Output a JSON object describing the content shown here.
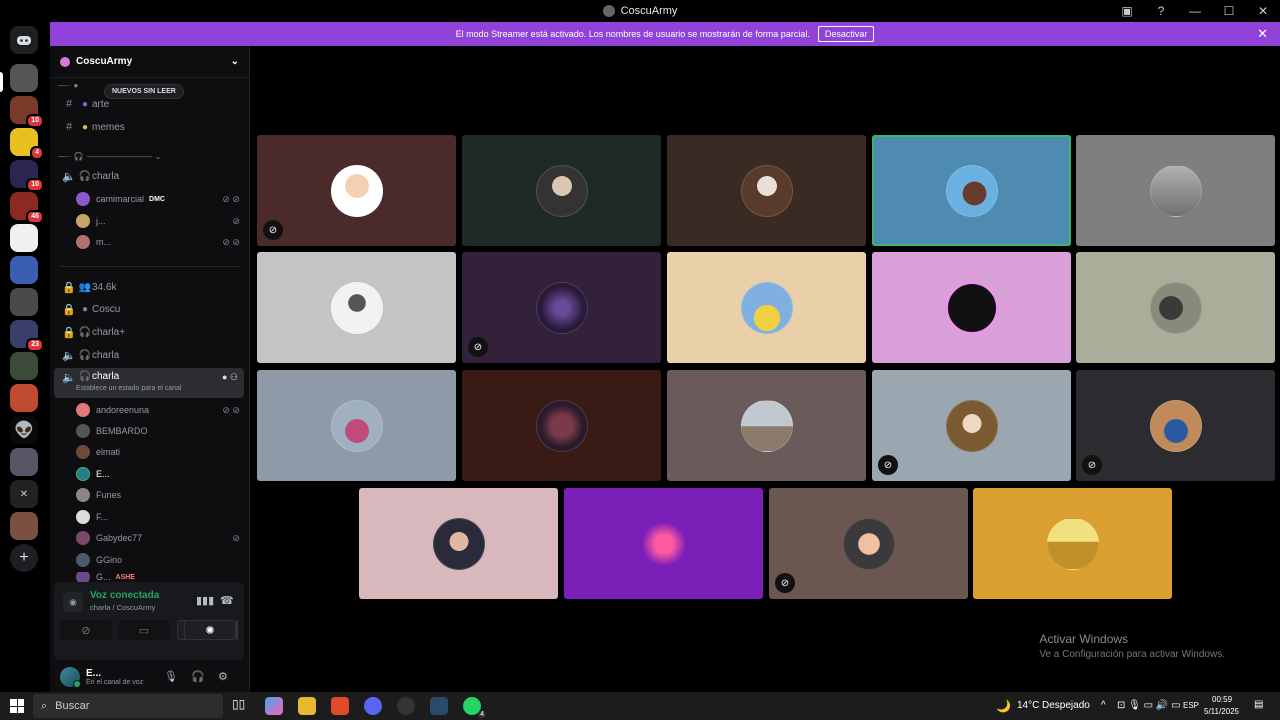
{
  "window": {
    "title": "CoscuArmy"
  },
  "banner": {
    "message": "El modo Streamer está activado. Los nombres de usuario se mostrarán de forma parcial.",
    "button": "Desactivar"
  },
  "server": {
    "name": "CoscuArmy"
  },
  "unread_pill": "NUEVOS SIN LEER",
  "channels_top": [
    {
      "name": "arte",
      "icon": "hash-icon"
    },
    {
      "name": "memes",
      "icon": "hash-icon"
    }
  ],
  "voice_channel_1": {
    "name": "charla"
  },
  "voice_users_1": [
    {
      "name": "camimarcial",
      "tag": "DMC"
    },
    {
      "name": "j..."
    },
    {
      "name": "m..."
    }
  ],
  "locked_channels": [
    {
      "name": "34.6k"
    },
    {
      "name": "Coscu"
    },
    {
      "name": "charla+"
    },
    {
      "name": "charla"
    }
  ],
  "active_channel": {
    "name": "charla",
    "status": "Establece un estado para el canal"
  },
  "voice_users_2": [
    {
      "name": "andoreenuna"
    },
    {
      "name": "BEMBARDO"
    },
    {
      "name": "elmati"
    },
    {
      "name": "E..."
    },
    {
      "name": "Funes"
    },
    {
      "name": "F..."
    },
    {
      "name": "Gabydec77"
    },
    {
      "name": "GGino"
    },
    {
      "name": "G...",
      "tag": "ASHE"
    }
  ],
  "voice_panel": {
    "status": "Voz conectada",
    "channel": "charla / CoscuArmy"
  },
  "user_panel": {
    "name": "E...",
    "status": "En el canal de voz"
  },
  "guild_badges": [
    "10",
    "4",
    "10",
    "46",
    "23"
  ],
  "activate_windows": {
    "title": "Activar Windows",
    "subtitle": "Ve a Configuración para activar Windows."
  },
  "taskbar": {
    "search": "Buscar",
    "weather": "14°C",
    "weather_desc": "Despejado",
    "lang": "ESP",
    "time": "00:59",
    "date": "5/11/2025",
    "whatsapp_badge": "4"
  },
  "colors": {
    "banner": "#9143d9",
    "speaking": "#3ab66f",
    "connected": "#23a55a"
  }
}
